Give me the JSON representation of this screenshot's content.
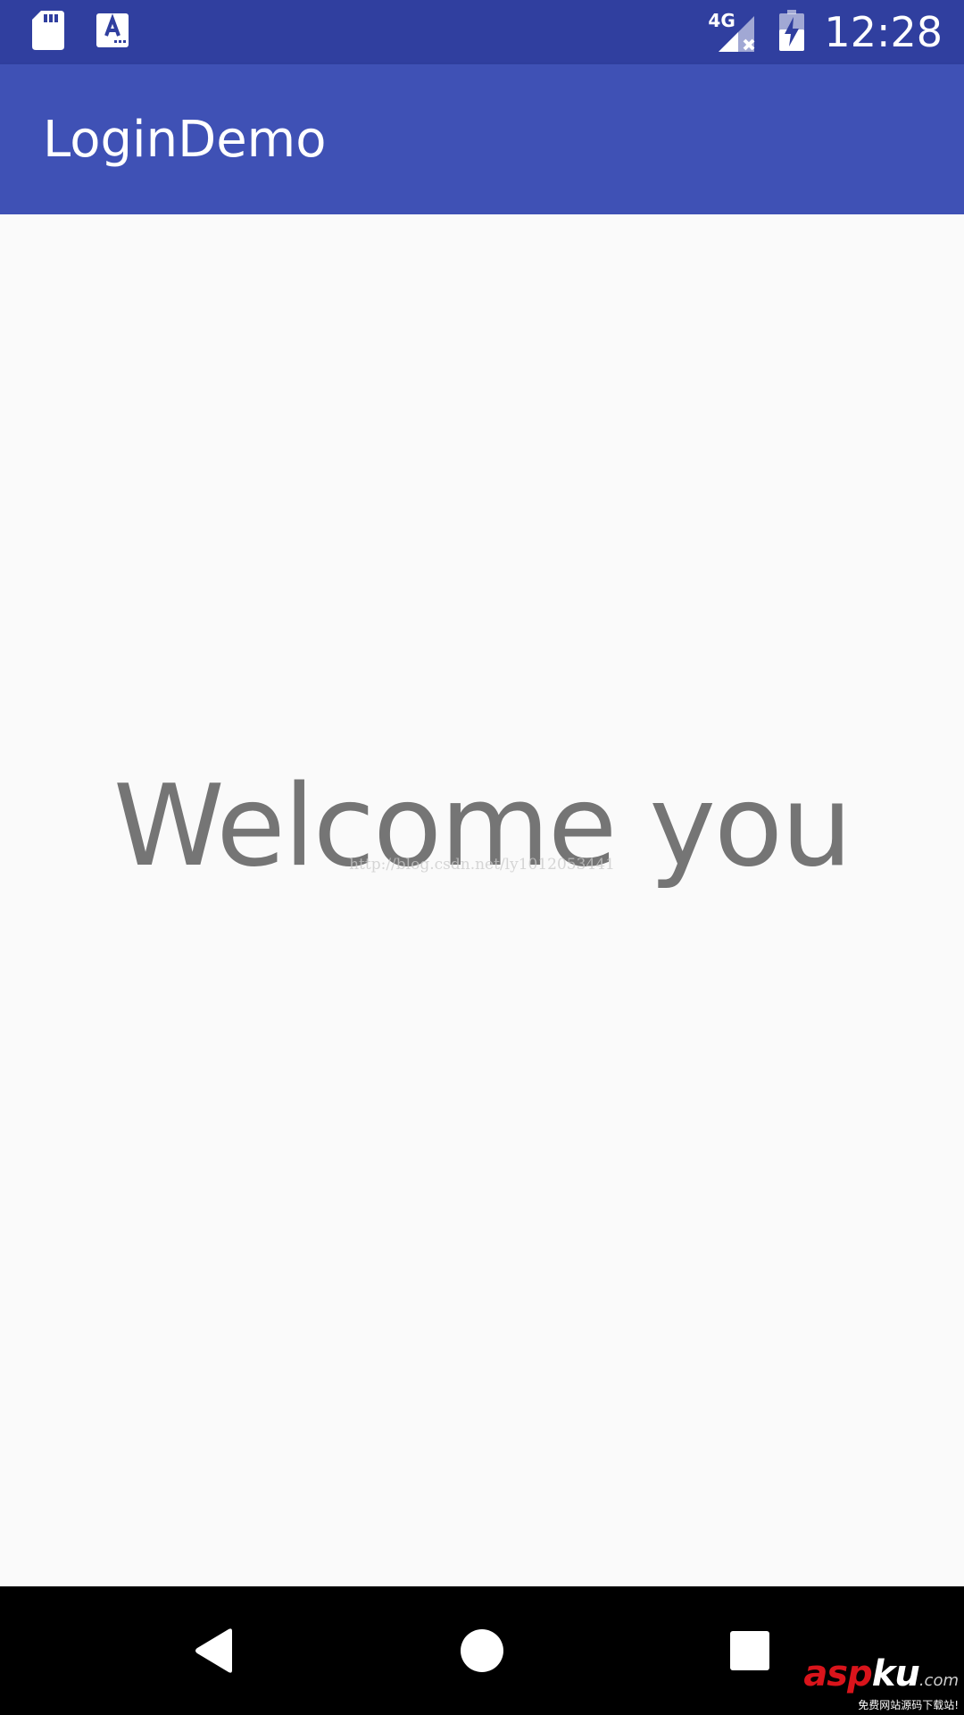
{
  "status_bar": {
    "time": "12:28",
    "network_label": "4G",
    "icons": [
      "sd-card-icon",
      "keyboard-a-icon",
      "signal-no-data-icon",
      "battery-charging-icon"
    ]
  },
  "app_bar": {
    "title": "LoginDemo"
  },
  "main": {
    "welcome_text": "Welcome you",
    "watermark_url": "http://blog.csdn.net/ly1012053441"
  },
  "nav_bar": {
    "icons": [
      "back-icon",
      "home-icon",
      "recents-icon"
    ]
  },
  "watermark": {
    "brand_red": "asp",
    "brand_white": "ku",
    "brand_suffix": ".com",
    "tagline": "免费网站源码下载站!"
  },
  "colors": {
    "status_bar": "#303F9F",
    "app_bar": "#3F51B5",
    "background": "#FAFAFA",
    "welcome_text": "#757575",
    "nav_bar": "#000000",
    "brand_red": "#D9141B"
  }
}
